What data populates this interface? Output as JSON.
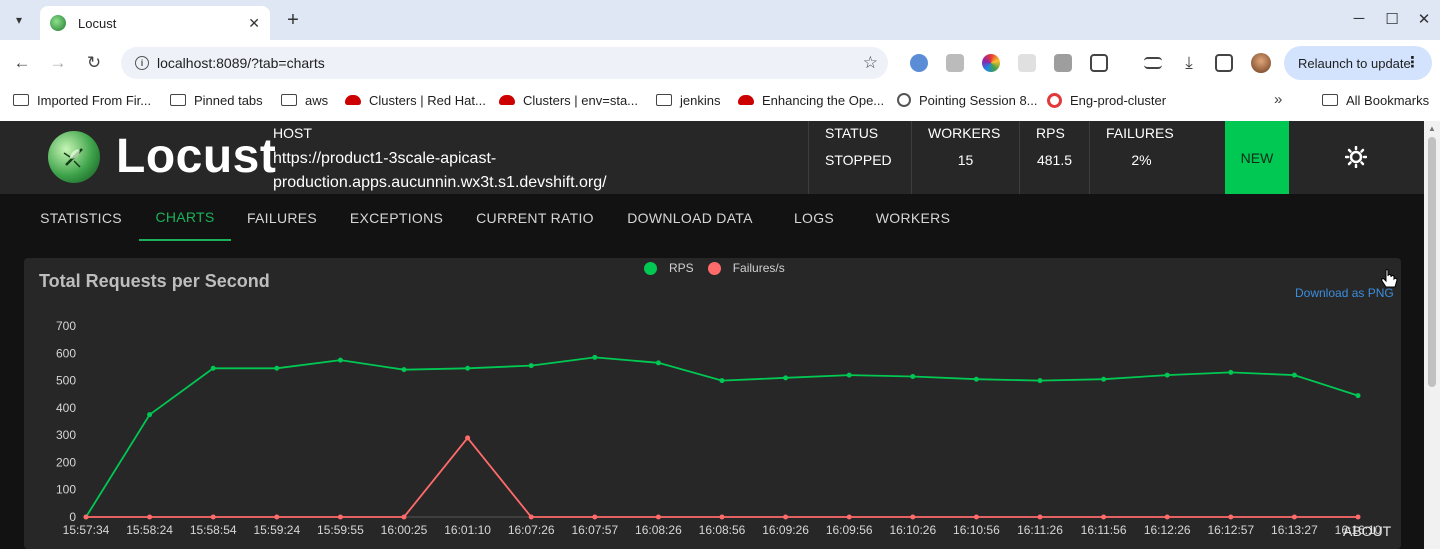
{
  "browser": {
    "tab_title": "Locust",
    "url": "localhost:8089/?tab=charts",
    "relaunch_label": "Relaunch to update",
    "bookmarks": [
      {
        "label": "Imported From Fir...",
        "icon": "folder-icon"
      },
      {
        "label": "Pinned tabs",
        "icon": "folder-icon"
      },
      {
        "label": "aws",
        "icon": "folder-icon"
      },
      {
        "label": "Clusters | Red Hat...",
        "icon": "redhat-icon"
      },
      {
        "label": "Clusters | env=sta...",
        "icon": "redhat-icon"
      },
      {
        "label": "jenkins",
        "icon": "folder-icon"
      },
      {
        "label": "Enhancing the Ope...",
        "icon": "redhat-icon"
      },
      {
        "label": "Pointing Session 8...",
        "icon": "globe-icon"
      },
      {
        "label": "Eng-prod-cluster",
        "icon": "openshift-icon"
      }
    ],
    "all_bookmarks_label": "All Bookmarks"
  },
  "app": {
    "logo_text": "Locust",
    "host_label": "HOST",
    "host_value": "https://product1-3scale-apicast-production.apps.aucunnin.wx3t.s1.devshift.org/",
    "stats": [
      {
        "label": "STATUS",
        "value": "STOPPED"
      },
      {
        "label": "WORKERS",
        "value": "15"
      },
      {
        "label": "RPS",
        "value": "481.5"
      },
      {
        "label": "FAILURES",
        "value": "2%"
      }
    ],
    "new_button": "NEW",
    "tabs": [
      "STATISTICS",
      "CHARTS",
      "FAILURES",
      "EXCEPTIONS",
      "CURRENT RATIO",
      "DOWNLOAD DATA",
      "LOGS",
      "WORKERS"
    ],
    "active_tab": "CHARTS",
    "download_label": "Download as PNG",
    "about_label": "ABOUT",
    "colors": {
      "accent": "#00c853",
      "rps": "#00c853",
      "failures": "#ff6b6b"
    }
  },
  "chart_data": {
    "type": "line",
    "title": "Total Requests per Second",
    "xlabel": "",
    "ylabel": "",
    "ylim": [
      0,
      700
    ],
    "yticks": [
      0,
      100,
      200,
      300,
      400,
      500,
      600,
      700
    ],
    "x": [
      "15:57:34",
      "15:58:24",
      "15:58:54",
      "15:59:24",
      "15:59:55",
      "16:00:25",
      "16:01:10",
      "16:07:26",
      "16:07:57",
      "16:08:26",
      "16:08:56",
      "16:09:26",
      "16:09:56",
      "16:10:26",
      "16:10:56",
      "16:11:26",
      "16:11:56",
      "16:12:26",
      "16:12:57",
      "16:13:27",
      "16:16:10"
    ],
    "series": [
      {
        "name": "RPS",
        "values": [
          0,
          375,
          545,
          545,
          575,
          540,
          545,
          555,
          585,
          565,
          500,
          510,
          520,
          515,
          505,
          500,
          505,
          520,
          530,
          520,
          445
        ]
      },
      {
        "name": "Failures/s",
        "values": [
          0,
          0,
          0,
          0,
          0,
          0,
          290,
          0,
          0,
          0,
          0,
          0,
          0,
          0,
          0,
          0,
          0,
          0,
          0,
          0,
          0
        ]
      }
    ],
    "legend_position": "top-center",
    "grid": false
  }
}
